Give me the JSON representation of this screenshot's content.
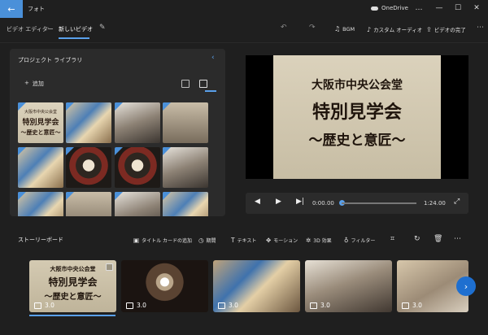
{
  "titlebar": {
    "app_title": "フォト",
    "onedrive": "OneDrive",
    "more": "…",
    "minimize": "—",
    "maximize": "☐",
    "close": "✕"
  },
  "toolbar": {
    "breadcrumb_parent": "ビデオ エディター",
    "breadcrumb_current": "新しいビデオ",
    "bgm": "BGM",
    "custom_audio": "カスタム オーディオ",
    "finish_video": "ビデオの完了",
    "more": "⋯"
  },
  "library": {
    "title": "プロジェクト ライブラリ",
    "add": "追加",
    "thumb_title": {
      "line1": "大阪市中央公会堂",
      "line2": "特別見学会",
      "line3": "〜歴史と意匠〜"
    }
  },
  "preview": {
    "line1": "大阪市中央公会堂",
    "line2": "特別見学会",
    "line3": "〜歴史と意匠〜"
  },
  "player": {
    "current_time": "0:00.00",
    "total_time": "1:24.00",
    "progress": 0.0
  },
  "storyboard": {
    "title": "ストーリーボード",
    "add_title_card": "タイトル カードの追加",
    "duration": "期間",
    "text": "テキスト",
    "motion": "モーション",
    "effects_3d": "3D 効果",
    "filters": "フィルター",
    "more": "⋯",
    "clips": [
      {
        "duration": "3.0",
        "line1": "大阪市中央公会堂",
        "line2": "特別見学会",
        "line3": "〜歴史と意匠〜"
      },
      {
        "duration": "3.0"
      },
      {
        "duration": "3.0"
      },
      {
        "duration": "3.0"
      },
      {
        "duration": "3.0"
      }
    ]
  },
  "colors": {
    "accent": "#5aa0ea",
    "background": "#1f1f1f",
    "panel": "#2b2b2b"
  }
}
